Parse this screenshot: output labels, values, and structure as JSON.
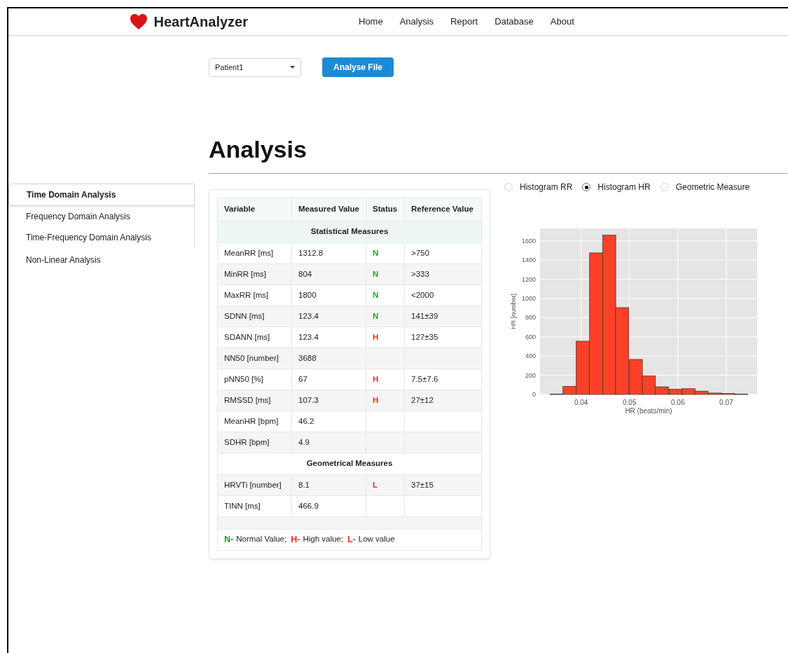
{
  "brand": "HeartAnalyzer",
  "nav": [
    {
      "label": "Home"
    },
    {
      "label": "Analysis"
    },
    {
      "label": "Report"
    },
    {
      "label": "Database"
    },
    {
      "label": "About"
    }
  ],
  "patient_select": {
    "value": "Patient1"
  },
  "analyse_button": "Analyse File",
  "page_title": "Analysis",
  "sidebar": {
    "items": [
      {
        "label": "Time Domain Analysis",
        "selected": true
      },
      {
        "label": "Frequency Domain Analysis",
        "selected": false
      },
      {
        "label": "Time-Frequency Domain Analysis",
        "selected": false
      },
      {
        "label": "Non-Linear Analysis",
        "selected": false
      }
    ]
  },
  "table": {
    "columns": [
      "Variable",
      "Measured Value",
      "Status",
      "Reference Value"
    ],
    "rows": [
      {
        "kind": "section",
        "label": "Statistical Measures",
        "highlighted": true
      },
      {
        "kind": "data",
        "cells": [
          "MeanRR [ms]",
          "1312.8",
          "N",
          ">750"
        ],
        "color": "#1e9e3a"
      },
      {
        "kind": "data",
        "cells": [
          "MinRR [ms]",
          "804",
          "N",
          ">333"
        ],
        "color": "#1e9e3a"
      },
      {
        "kind": "data",
        "cells": [
          "MaxRR [ms]",
          "1800",
          "N",
          "<2000"
        ],
        "color": "#1e9e3a"
      },
      {
        "kind": "data",
        "cells": [
          "SDNN [ms]",
          "123.4",
          "N",
          "141±39"
        ],
        "color": "#1e9e3a"
      },
      {
        "kind": "data",
        "cells": [
          "SDANN [ms]",
          "123.4",
          "H",
          "127±35"
        ],
        "color": "#f0302a"
      },
      {
        "kind": "data",
        "cells": [
          "NN50 [number]",
          "3688"
        ]
      },
      {
        "kind": "data",
        "cells": [
          "pNN50 [%]",
          "67",
          "H",
          "7.5±7.6"
        ],
        "color": "#f0302a"
      },
      {
        "kind": "data",
        "cells": [
          "RMSSD [ms]",
          "107.3",
          "H",
          "27±12"
        ],
        "color": "#f0302a"
      },
      {
        "kind": "data",
        "cells": [
          "MeanHR [bpm]",
          "46.2"
        ]
      },
      {
        "kind": "data",
        "cells": [
          "SDHR [bpm]",
          "4.9"
        ]
      },
      {
        "kind": "section",
        "label": "Geometrical Measures",
        "highlighted": false
      },
      {
        "kind": "data",
        "cells": [
          "HRVTi [number]",
          "8.1",
          "L",
          "37±15"
        ],
        "color": "#f0302a"
      },
      {
        "kind": "data",
        "cells": [
          "TINN [ms]",
          "466.9"
        ]
      },
      {
        "kind": "blank"
      }
    ],
    "legend": [
      {
        "key": "N-",
        "text": "Normal Value;",
        "color": "#1e9e3a"
      },
      {
        "key": "H-",
        "text": "High value;",
        "color": "#f0302a"
      },
      {
        "key": "L-",
        "text": "Low value",
        "color": "#f0302a"
      }
    ]
  },
  "chart_options": [
    {
      "label": "Histogram RR",
      "selected": false
    },
    {
      "label": "Histogram HR",
      "selected": true
    },
    {
      "label": "Geometric Measure",
      "selected": false
    }
  ],
  "chart_data": {
    "type": "bar",
    "xlabel": "HR (beats/min)",
    "ylabel": "HR [number]",
    "x": [
      0.0349,
      0.0376,
      0.0403,
      0.0431,
      0.0458,
      0.0485,
      0.0513,
      0.054,
      0.0567,
      0.0595,
      0.0622,
      0.0649,
      0.0677,
      0.0704,
      0.0731
    ],
    "grid": true,
    "series": [
      {
        "color": "#fc4128",
        "values": [
          5,
          85,
          555,
          1475,
          1660,
          905,
          365,
          195,
          80,
          55,
          60,
          35,
          15,
          10,
          5
        ]
      }
    ],
    "xlim": [
      0.0315,
      0.0764
    ],
    "ylim": [
      0,
      1730
    ],
    "xticks": [
      {
        "value": 0.04,
        "label": "0.04"
      },
      {
        "value": 0.05,
        "label": "0.05"
      },
      {
        "value": 0.06,
        "label": "0.06"
      },
      {
        "value": 0.07,
        "label": "0.07"
      }
    ],
    "yticks": [
      0,
      200,
      400,
      600,
      800,
      1000,
      1200,
      1400,
      1600
    ]
  }
}
